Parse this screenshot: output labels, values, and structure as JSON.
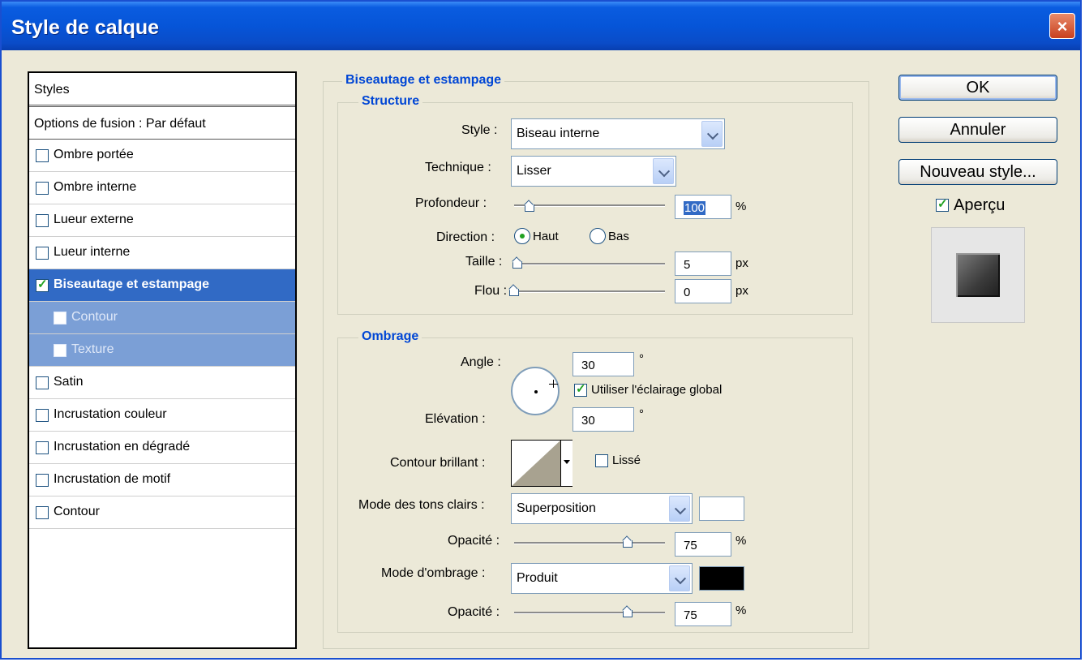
{
  "window": {
    "title": "Style de calque",
    "close_glyph": "×"
  },
  "styles_panel": {
    "header": "Styles",
    "blend_options": "Options de fusion : Par défaut",
    "items": [
      {
        "label": "Ombre portée",
        "checked": false
      },
      {
        "label": "Ombre interne",
        "checked": false
      },
      {
        "label": "Lueur externe",
        "checked": false
      },
      {
        "label": "Lueur interne",
        "checked": false
      },
      {
        "label": "Biseautage et estampage",
        "checked": true,
        "selected": true
      },
      {
        "label": "Contour",
        "checked": false,
        "sub": true
      },
      {
        "label": "Texture",
        "checked": false,
        "sub": true
      },
      {
        "label": "Satin",
        "checked": false
      },
      {
        "label": "Incrustation couleur",
        "checked": false
      },
      {
        "label": "Incrustation en dégradé",
        "checked": false
      },
      {
        "label": "Incrustation de motif",
        "checked": false
      },
      {
        "label": "Contour",
        "checked": false
      }
    ]
  },
  "section": {
    "title": "Biseautage et estampage",
    "structure": {
      "title": "Structure",
      "style_label": "Style :",
      "style_value": "Biseau interne",
      "technique_label": "Technique :",
      "technique_value": "Lisser",
      "depth_label": "Profondeur :",
      "depth_value": "100",
      "depth_unit": "%",
      "depth_slider_fraction": 0.1,
      "direction_label": "Direction :",
      "direction_up": "Haut",
      "direction_down": "Bas",
      "size_label": "Taille :",
      "size_value": "5",
      "size_unit": "px",
      "size_slider_fraction": 0.02,
      "soften_label": "Flou :",
      "soften_value": "0",
      "soften_unit": "px",
      "soften_slider_fraction": 0.0
    },
    "shading": {
      "title": "Ombrage",
      "angle_label": "Angle :",
      "angle_value": "30",
      "angle_unit": "°",
      "global_light_label": "Utiliser l'éclairage global",
      "global_light_checked": true,
      "altitude_label": "Elévation :",
      "altitude_value": "30",
      "altitude_unit": "°",
      "gloss_label": "Contour brillant :",
      "antialias_label": "Lissé",
      "highlight_mode_label": "Mode des tons clairs :",
      "highlight_mode_value": "Superposition",
      "highlight_color": "#ffffff",
      "highlight_opacity_label": "Opacité :",
      "highlight_opacity_value": "75",
      "highlight_opacity_unit": "%",
      "highlight_opacity_fraction": 0.75,
      "shadow_mode_label": "Mode d'ombrage :",
      "shadow_mode_value": "Produit",
      "shadow_color": "#000000",
      "shadow_opacity_label": "Opacité :",
      "shadow_opacity_value": "75",
      "shadow_opacity_unit": "%",
      "shadow_opacity_fraction": 0.75
    }
  },
  "buttons": {
    "ok": "OK",
    "cancel": "Annuler",
    "new_style": "Nouveau style...",
    "preview_label": "Aperçu",
    "preview_checked": true
  },
  "colors": {
    "title_bar": "#0655d8",
    "selection": "#316ac5",
    "group_title": "#0046d5"
  }
}
